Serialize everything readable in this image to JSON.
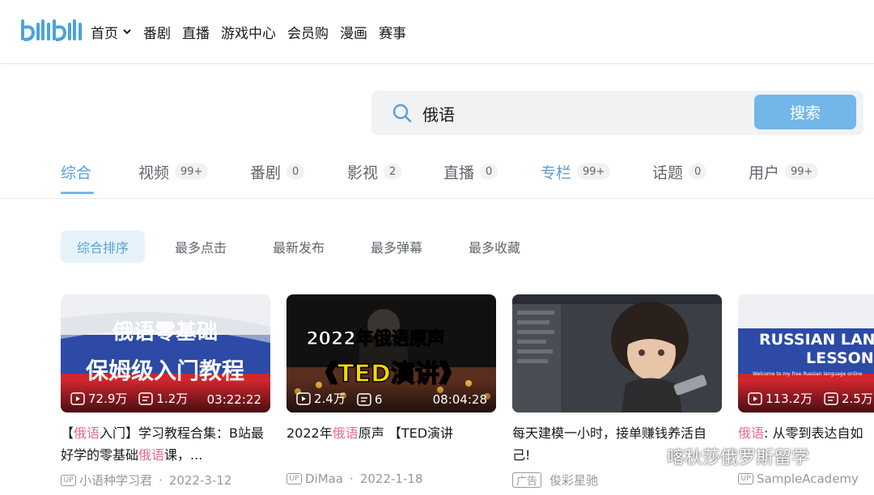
{
  "nav": {
    "items": [
      {
        "label": "首页",
        "has_dropdown": true
      },
      {
        "label": "番剧"
      },
      {
        "label": "直播"
      },
      {
        "label": "游戏中心"
      },
      {
        "label": "会员购"
      },
      {
        "label": "漫画"
      },
      {
        "label": "赛事"
      }
    ]
  },
  "search": {
    "value": "俄语",
    "button_label": "搜索"
  },
  "tabs": [
    {
      "label": "综合",
      "count": ""
    },
    {
      "label": "视频",
      "count": "99+"
    },
    {
      "label": "番剧",
      "count": "0"
    },
    {
      "label": "影视",
      "count": "2"
    },
    {
      "label": "直播",
      "count": "0"
    },
    {
      "label": "专栏",
      "count": "99+"
    },
    {
      "label": "话题",
      "count": "0"
    },
    {
      "label": "用户",
      "count": "99+"
    }
  ],
  "sort_options": [
    "综合排序",
    "最多点击",
    "最新发布",
    "最多弹幕",
    "最多收藏"
  ],
  "cards": [
    {
      "thumb_line1": "俄语零基础",
      "thumb_line2": "保姆级入门教程",
      "plays": "72.9万",
      "danmaku": "1.2万",
      "duration": "03:22:22",
      "title_parts": [
        "【",
        "俄语",
        "入门】学习教程合集：B站最好学的零基础",
        "俄语",
        "课，..."
      ],
      "author": "小语种学习君",
      "date": "2022-3-12"
    },
    {
      "thumb_line1": "2022年俄语原声",
      "thumb_line2": "《TED演讲》",
      "plays": "2.4万",
      "danmaku": "6",
      "duration": "08:04:28",
      "title_parts": [
        "2022年",
        "俄语",
        "原声 【TED演讲",
        "",
        ""
      ],
      "author": "DiMaa",
      "date": "2022-1-18"
    },
    {
      "title_parts": [
        "每天建模一小时，接单赚钱养活自己!",
        "",
        "",
        "",
        ""
      ],
      "ad_label": "广告",
      "author": "俊彩星驰"
    },
    {
      "thumb_line1": "RUSSIAN LANG",
      "thumb_line2": "LESSONS",
      "thumb_small": "Welcome to my free Russian language online",
      "plays": "113.2万",
      "danmaku": "2.5万",
      "title_parts": [
        "",
        "俄语",
        ": 从零到表达自如",
        "",
        ""
      ],
      "author": "SampleAcademy"
    }
  ],
  "watermark": "喀秋莎俄罗斯留学",
  "colors": {
    "accent": "#73b6ea",
    "keyword": "#e76b8d"
  }
}
